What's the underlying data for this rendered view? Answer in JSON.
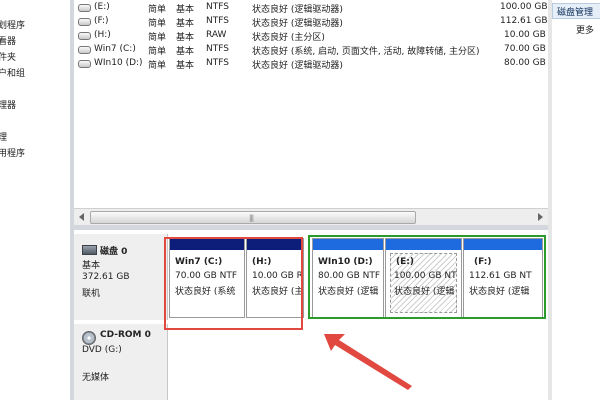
{
  "left_nav": [
    "划程序",
    "看器",
    "件夹",
    "户和组",
    "理器",
    "理",
    "用程序"
  ],
  "volume_list": [
    {
      "name": "(E:)",
      "layout": "简单",
      "type": "基本",
      "fs": "NTFS",
      "status": "状态良好 (逻辑驱动器)",
      "capacity": "100.00 GB"
    },
    {
      "name": "(F:)",
      "layout": "简单",
      "type": "基本",
      "fs": "NTFS",
      "status": "状态良好 (逻辑驱动器)",
      "capacity": "112.61 GB"
    },
    {
      "name": "(H:)",
      "layout": "简单",
      "type": "基本",
      "fs": "RAW",
      "status": "状态良好 (主分区)",
      "capacity": "10.00 GB"
    },
    {
      "name": "Win7 (C:)",
      "layout": "简单",
      "type": "基本",
      "fs": "NTFS",
      "status": "状态良好 (系统, 启动, 页面文件, 活动, 故障转储, 主分区)",
      "capacity": "70.00 GB"
    },
    {
      "name": "WIn10 (D:)",
      "layout": "简单",
      "type": "基本",
      "fs": "NTFS",
      "status": "状态良好 (逻辑驱动器)",
      "capacity": "80.00 GB"
    }
  ],
  "disk0": {
    "label": "磁盘 0",
    "type": "基本",
    "size": "372.61 GB",
    "state": "联机"
  },
  "partitions": [
    {
      "name": "Win7  (C:)",
      "size": "70.00 GB NTF",
      "status": "状态良好 (系统",
      "bar_color": "#0d1e7a"
    },
    {
      "name": "(H:)",
      "size": "10.00 GB R",
      "status": "状态良好 (主",
      "bar_color": "#0d1e7a"
    },
    {
      "name": "WIn10  (D:)",
      "size": "80.00 GB NTF",
      "status": "状态良好 (逻辑",
      "bar_color": "#1e6be0"
    },
    {
      "name": "(E:)",
      "size": "100.00 GB NT",
      "status": "状态良好 (逻辑",
      "bar_color": "#1e6be0"
    },
    {
      "name": "(F:)",
      "size": "112.61 GB NT",
      "status": "状态良好 (逻辑",
      "bar_color": "#1e6be0"
    }
  ],
  "cdrom": {
    "label": "CD-ROM 0",
    "drive": "DVD (G:)",
    "media": "无媒体"
  },
  "right_pane": {
    "header": "磁盘管理",
    "more": "更多"
  },
  "colors": {
    "primary_bar": "#0d1e7a",
    "logical_bar": "#1e6be0",
    "highlight_red": "#e1483f",
    "highlight_green": "#2c9a2c"
  }
}
